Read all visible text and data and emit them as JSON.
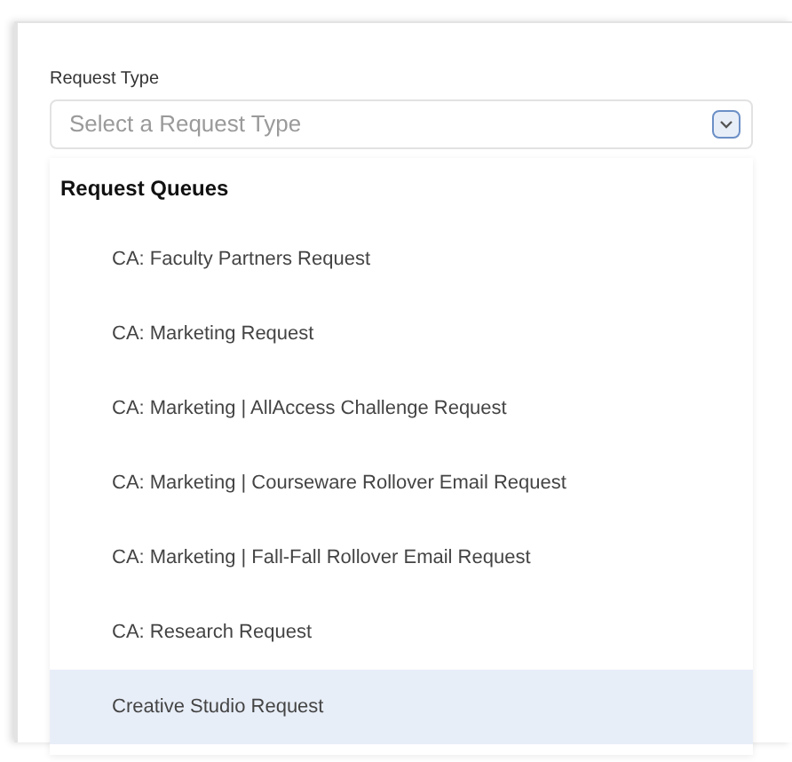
{
  "field": {
    "label": "Request Type",
    "placeholder": "Select a Request Type",
    "expanded": true
  },
  "dropdown": {
    "group_title": "Request Queues",
    "options": [
      {
        "label": "CA: Faculty Partners Request",
        "selected": false
      },
      {
        "label": "CA: Marketing Request",
        "selected": false
      },
      {
        "label": "CA: Marketing | AllAccess Challenge Request",
        "selected": false
      },
      {
        "label": "CA: Marketing | Courseware Rollover Email Request",
        "selected": false
      },
      {
        "label": "CA: Marketing | Fall-Fall Rollover Email Request",
        "selected": false
      },
      {
        "label": "CA: Research Request",
        "selected": false
      },
      {
        "label": "Creative Studio Request",
        "selected": true
      }
    ]
  }
}
